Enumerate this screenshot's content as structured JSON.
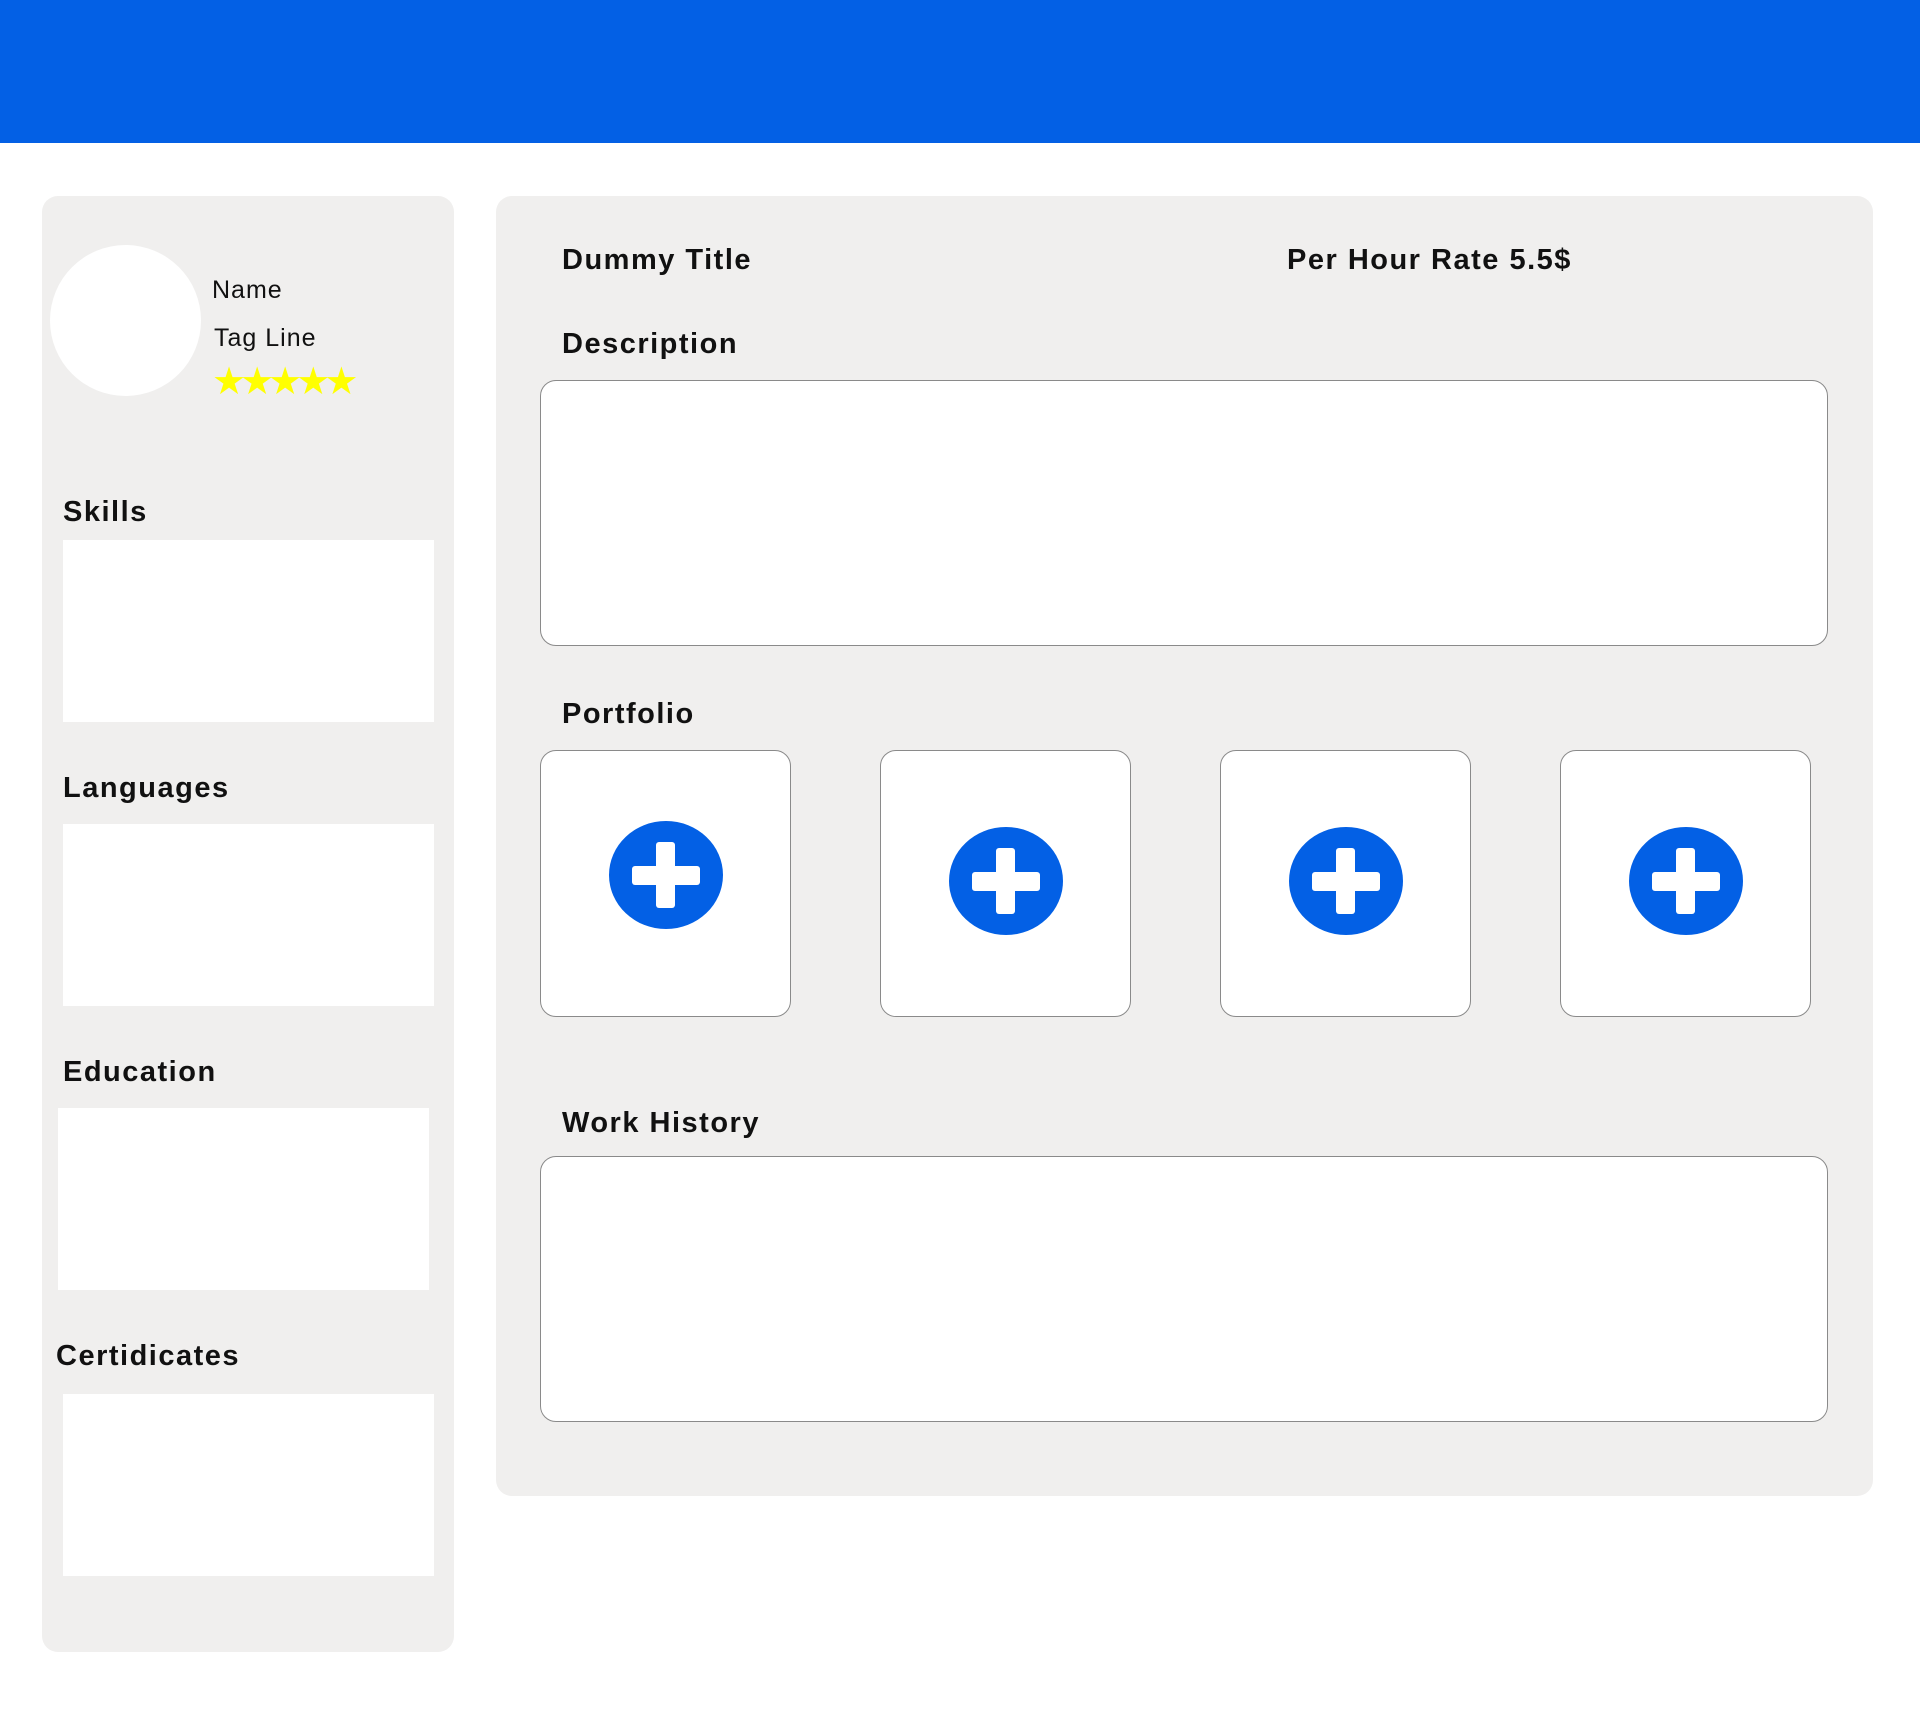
{
  "profile": {
    "name": "Name",
    "tagline": "Tag Line",
    "rating_stars": 5,
    "rating_max": 5,
    "rating_symbol": "★",
    "rating_color": "#ffff00"
  },
  "sidebar": {
    "sections": [
      {
        "label": "Skills"
      },
      {
        "label": "Languages"
      },
      {
        "label": "Education"
      },
      {
        "label": "Certidicates"
      }
    ]
  },
  "main": {
    "title": "Dummy Title",
    "rate": "Per Hour Rate 5.5$",
    "description_label": "Description",
    "portfolio_label": "Portfolio",
    "portfolio_tiles": [
      {
        "icon": "plus-circle-icon"
      },
      {
        "icon": "plus-circle-icon"
      },
      {
        "icon": "plus-circle-icon"
      },
      {
        "icon": "plus-circle-icon"
      }
    ],
    "work_history_label": "Work History"
  },
  "theme": {
    "accent": "#0360e5",
    "panel_bg": "#f0efee",
    "box_bg": "#ffffff"
  }
}
